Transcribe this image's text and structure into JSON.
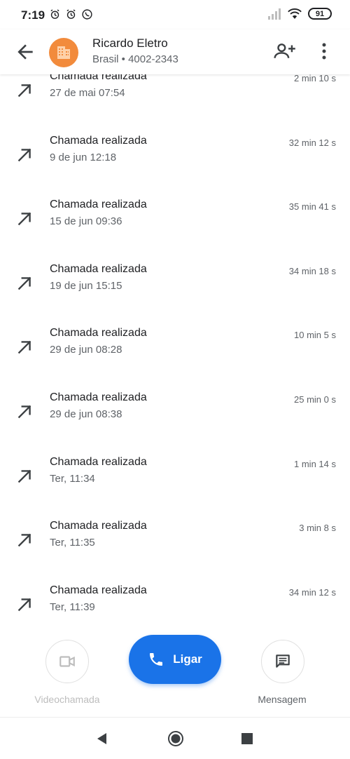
{
  "status_bar": {
    "time": "7:19",
    "battery": "91",
    "icons": [
      "alarm-icon",
      "alarm-icon",
      "whatsapp-icon",
      "signal-icon",
      "wifi-icon",
      "battery-icon"
    ]
  },
  "header": {
    "contact_name": "Ricardo Eletro",
    "contact_sub": "Brasil • 4002-2343",
    "avatar_color": "#f28b3c",
    "icons": [
      "back-arrow-icon",
      "building-icon",
      "add-contact-icon",
      "more-vert-icon"
    ]
  },
  "calls": [
    {
      "title": "Chamada realizada",
      "date": "27 de mai 07:54",
      "duration": "2 min 10 s"
    },
    {
      "title": "Chamada realizada",
      "date": "9 de jun 12:18",
      "duration": "32 min 12 s"
    },
    {
      "title": "Chamada realizada",
      "date": "15 de jun 09:36",
      "duration": "35 min 41 s"
    },
    {
      "title": "Chamada realizada",
      "date": "19 de jun 15:15",
      "duration": "34 min 18 s"
    },
    {
      "title": "Chamada realizada",
      "date": "29 de jun 08:28",
      "duration": "10 min 5 s"
    },
    {
      "title": "Chamada realizada",
      "date": "29 de jun 08:38",
      "duration": "25 min 0 s"
    },
    {
      "title": "Chamada realizada",
      "date": "Ter, 11:34",
      "duration": "1 min 14 s"
    },
    {
      "title": "Chamada realizada",
      "date": "Ter, 11:35",
      "duration": "3 min 8 s"
    },
    {
      "title": "Chamada realizada",
      "date": "Ter, 11:39",
      "duration": "34 min 12 s"
    }
  ],
  "actions": {
    "video_label": "Videochamada",
    "call_label": "Ligar",
    "message_label": "Mensagem",
    "accent_color": "#1a73e8"
  }
}
